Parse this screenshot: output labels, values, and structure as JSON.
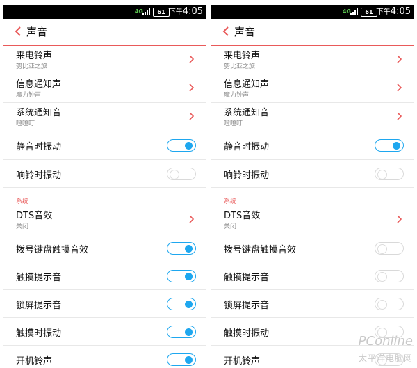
{
  "left": {
    "status": {
      "network": "4G",
      "battery": "61",
      "ampm": "下午",
      "time": "4:05"
    },
    "title": "声音",
    "rows": [
      {
        "label": "来电铃声",
        "sub": "努比亚之旅"
      },
      {
        "label": "信息通知声",
        "sub": "魔力钟声"
      },
      {
        "label": "系统通知音",
        "sub": "噔噔叮"
      },
      {
        "label": "静音时振动",
        "toggle": true
      },
      {
        "label": "响铃时振动",
        "toggle": false
      },
      {
        "section": "系统"
      },
      {
        "label": "DTS音效",
        "sub": "关闭"
      },
      {
        "label": "拨号键盘触摸音效",
        "toggle": true
      },
      {
        "label": "触摸提示音",
        "toggle": true
      },
      {
        "label": "锁屏提示音",
        "toggle": true
      },
      {
        "label": "触摸时振动",
        "toggle": true
      },
      {
        "label": "开机铃声",
        "toggle": true
      }
    ]
  },
  "right": {
    "status": {
      "network": "4G",
      "battery": "61",
      "ampm": "下午",
      "time": "4:05"
    },
    "title": "声音",
    "rows": [
      {
        "label": "来电铃声",
        "sub": "努比亚之旅"
      },
      {
        "label": "信息通知声",
        "sub": "魔力钟声"
      },
      {
        "label": "系统通知音",
        "sub": "噔噔叮"
      },
      {
        "label": "静音时振动",
        "toggle": true
      },
      {
        "label": "响铃时振动",
        "toggle": false
      },
      {
        "section": "系统"
      },
      {
        "label": "DTS音效",
        "sub": "关闭"
      },
      {
        "label": "拨号键盘触摸音效",
        "toggle": false
      },
      {
        "label": "触摸提示音",
        "toggle": false
      },
      {
        "label": "锁屏提示音",
        "toggle": false
      },
      {
        "label": "触摸时振动",
        "toggle": false
      },
      {
        "label": "开机铃声",
        "toggle": false
      }
    ]
  },
  "colors": {
    "accent": "#e95a5a",
    "toggle_on": "#1ea7ef",
    "toggle_off": "#d9d9d9",
    "divider": "#e8e8e8"
  },
  "watermark": {
    "main": "PConline",
    "sub": "太平洋电脑网"
  }
}
